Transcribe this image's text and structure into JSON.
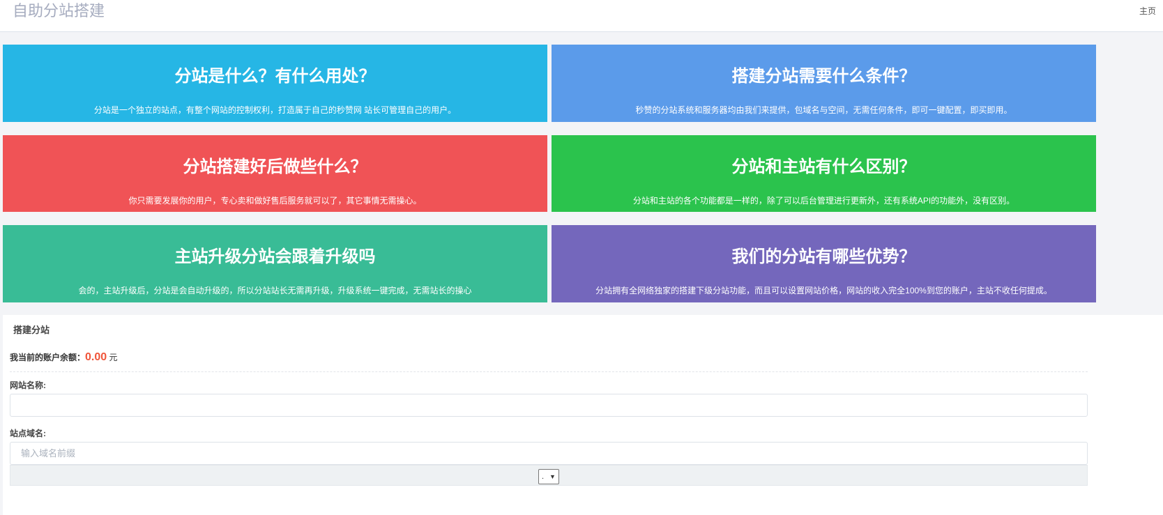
{
  "header": {
    "brand": "自助分站搭建",
    "home_link": "主页"
  },
  "cards": [
    {
      "title": "分站是什么？有什么用处？",
      "desc": "分站是一个独立的站点，有整个网站的控制权利，打造属于自己的秒赞网 站长可管理自己的用户。",
      "color": "#26b6e5"
    },
    {
      "title": "搭建分站需要什么条件？",
      "desc": "秒赞的分站系统和服务器均由我们来提供，包域名与空间，无需任何条件，即可一键配置，即买即用。",
      "color": "#5b9bea"
    },
    {
      "title": "分站搭建好后做些什么？",
      "desc": "你只需要发展你的用户，专心卖和做好售后服务就可以了，其它事情无需操心。",
      "color": "#f05356"
    },
    {
      "title": "分站和主站有什么区别？",
      "desc": "分站和主站的各个功能都是一样的，除了可以后台管理进行更新外，还有系统API的功能外，没有区别。",
      "color": "#2bc34d"
    },
    {
      "title": "主站升级分站会跟着升级吗",
      "desc": "会的，主站升级后，分站是会自动升级的，所以分站站长无需再升级，升级系统一键完成，无需站长的操心",
      "color": "#39bc96"
    },
    {
      "title": "我们的分站有哪些优势？",
      "desc": "分站拥有全网络独家的搭建下级分站功能，而且可以设置网站价格，网站的收入完全100%到您的账户，主站不收任何提成。",
      "color": "#7467bc"
    }
  ],
  "form": {
    "title": "搭建分站",
    "balance_label": "我当前的账户余额：",
    "balance_amount": "0.00",
    "balance_unit": "元",
    "site_name_label": "网站名称:",
    "site_name_value": "",
    "domain_label": "站点域名:",
    "domain_placeholder": "输入域名前缀",
    "domain_suffix_selected": ".",
    "caret_icon": "▼"
  }
}
